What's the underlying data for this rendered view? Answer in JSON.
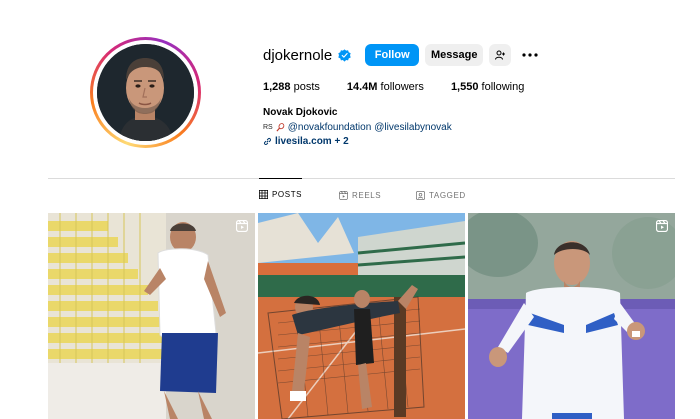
{
  "profile": {
    "username": "djokernole",
    "follow_label": "Follow",
    "message_label": "Message",
    "stats": {
      "posts_count": "1,288",
      "posts_label": "posts",
      "followers_count": "14.4M",
      "followers_label": "followers",
      "following_count": "1,550",
      "following_label": "following"
    },
    "full_name": "Novak Djokovic",
    "bio_prefix": "RS",
    "mention_1": "@novakfoundation",
    "mention_2": "@livesilabynovak",
    "link": "livesila.com + 2"
  },
  "tabs": [
    {
      "label": "POSTS",
      "icon": "grid-icon",
      "active": true
    },
    {
      "label": "REELS",
      "icon": "reels-icon",
      "active": false
    },
    {
      "label": "TAGGED",
      "icon": "tagged-icon",
      "active": false
    }
  ],
  "colors": {
    "accent": "#0095f6",
    "verified": "#0095f6",
    "link": "#00376b",
    "divider": "#dbdbdb"
  }
}
